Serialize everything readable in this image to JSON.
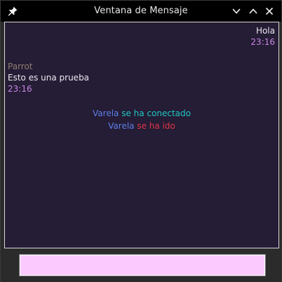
{
  "window": {
    "title": "Ventana de Mensaje"
  },
  "icons": {
    "pin": "pin-icon",
    "minimize": "chevron-down-icon",
    "maximize": "chevron-up-icon",
    "close": "close-icon"
  },
  "colors": {
    "chat_background": "#251c35",
    "timestamp": "#c887e6",
    "author": "#8e7e70",
    "user_name": "#5d7fe8",
    "joined_text": "#21c8c3",
    "left_text": "#e03545",
    "input_background": "#fcc9ff"
  },
  "messages": {
    "own": {
      "text": "Hola",
      "time": "23:16"
    },
    "incoming": {
      "author": "Parrot",
      "text": "Esto es una prueba",
      "time": "23:16"
    },
    "events": [
      {
        "user": "Varela",
        "action": "se ha conectado"
      },
      {
        "user": "Varela",
        "action": "se ha ido"
      }
    ]
  },
  "input": {
    "value": ""
  }
}
